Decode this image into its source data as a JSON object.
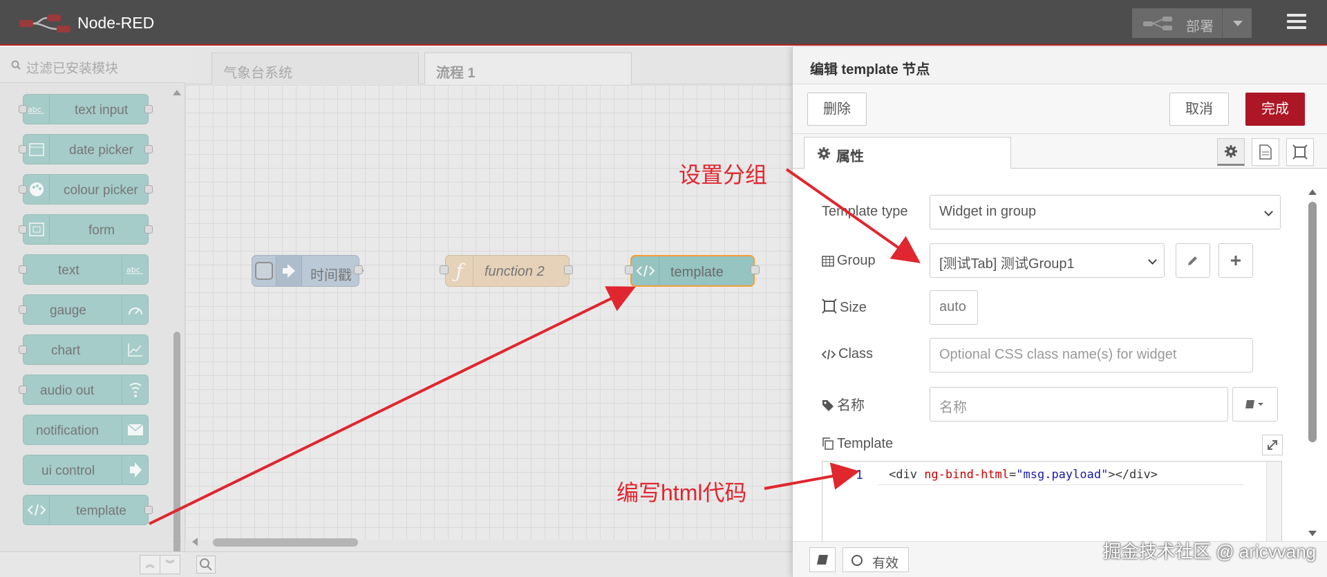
{
  "header": {
    "app_title": "Node-RED",
    "deploy_label": "部署"
  },
  "palette": {
    "search_placeholder": "过滤已安装模块",
    "nodes": [
      {
        "label": "text input",
        "icon": "abc-icon",
        "icon_side": "left"
      },
      {
        "label": "date picker",
        "icon": "calendar-icon",
        "icon_side": "left"
      },
      {
        "label": "colour picker",
        "icon": "palette-icon",
        "icon_side": "left"
      },
      {
        "label": "form",
        "icon": "form-icon",
        "icon_side": "left"
      },
      {
        "label": "text",
        "icon": "abc-icon",
        "icon_side": "right"
      },
      {
        "label": "gauge",
        "icon": "gauge-icon",
        "icon_side": "right"
      },
      {
        "label": "chart",
        "icon": "chart-icon",
        "icon_side": "right"
      },
      {
        "label": "audio out",
        "icon": "audio-icon",
        "icon_side": "right"
      },
      {
        "label": "notification",
        "icon": "envelope-icon",
        "icon_side": "right"
      },
      {
        "label": "ui control",
        "icon": "arrow-icon",
        "icon_side": "right"
      },
      {
        "label": "template",
        "icon": "code-icon",
        "icon_side": "left"
      }
    ]
  },
  "workspace": {
    "tabs": [
      {
        "label": "气象台系统",
        "active": false
      },
      {
        "label": "流程 1",
        "active": true
      }
    ],
    "flow_nodes": {
      "inject": "时间戳",
      "function": "function 2",
      "template": "template"
    }
  },
  "tray": {
    "title": "编辑 template 节点",
    "delete_label": "删除",
    "cancel_label": "取消",
    "done_label": "完成",
    "properties_tab": "属性",
    "fields": {
      "template_type_label": "Template type",
      "template_type_value": "Widget in group",
      "group_label": "Group",
      "group_value": "[测试Tab] 测试Group1",
      "size_label": "Size",
      "size_value": "auto",
      "class_label": "Class",
      "class_placeholder": "Optional CSS class name(s) for widget",
      "name_label": "名称",
      "name_placeholder": "名称",
      "template_label": "Template"
    },
    "editor": {
      "line_number": "1",
      "code_tag_open": "<div ",
      "code_attr": "ng-bind-html",
      "code_eq": "=",
      "code_value": "\"msg.payload\"",
      "code_tag_close": "></div>"
    },
    "enabled_label": "有效"
  },
  "annotations": {
    "set_group": "设置分组",
    "write_html": "编写html代码",
    "arrow_color": "#e0262e"
  },
  "watermark": "掘金技术社区 @ aricvvang",
  "colors": {
    "header_bg": "#4d4d4d",
    "ui_node": "#93c7c2",
    "function_node": "#e8c9a0",
    "inject_node": "#a6bbcf",
    "done_button": "#ad1625"
  }
}
